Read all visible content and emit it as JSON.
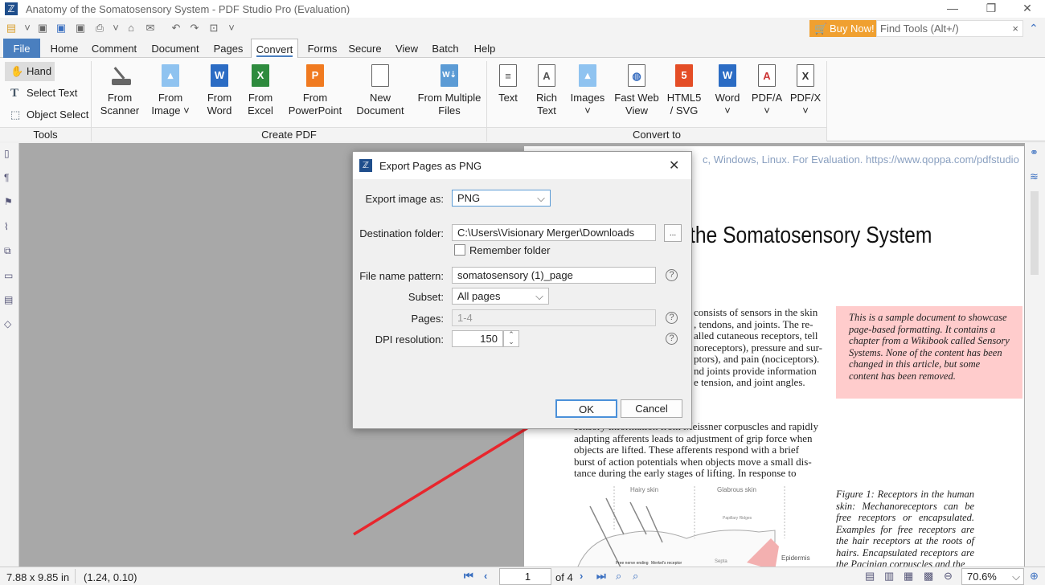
{
  "window": {
    "title": "Anatomy of the Somatosensory System - PDF Studio Pro (Evaluation)",
    "minimize": "—",
    "restore": "❐",
    "close": "✕"
  },
  "quick_toolbar": {
    "buy_now": "Buy Now!",
    "find_tools_placeholder": "Find Tools  (Alt+/)",
    "find_clear": "×"
  },
  "menu": {
    "tabs": [
      "File",
      "Home",
      "Comment",
      "Document",
      "Pages",
      "Convert",
      "Forms",
      "Secure",
      "View",
      "Batch",
      "Help"
    ],
    "active": "Convert"
  },
  "ribbon": {
    "tools": {
      "label": "Tools",
      "items": [
        "Hand",
        "Select Text",
        "Object Select"
      ]
    },
    "create_pdf": {
      "label": "Create PDF",
      "items": [
        [
          "From",
          "Scanner"
        ],
        [
          "From",
          "Image ˅"
        ],
        [
          "From",
          "Word"
        ],
        [
          "From",
          "Excel"
        ],
        [
          "From",
          "PowerPoint"
        ],
        [
          "New",
          "Document"
        ],
        [
          "From Multiple",
          "Files"
        ]
      ]
    },
    "convert_to": {
      "label": "Convert to",
      "items": [
        [
          "Text",
          ""
        ],
        [
          "Rich",
          "Text"
        ],
        [
          "Images",
          "˅"
        ],
        [
          "Fast Web",
          "View"
        ],
        [
          "HTML5",
          "/ SVG"
        ],
        [
          "Word",
          "˅"
        ],
        [
          "PDF/A",
          "˅"
        ],
        [
          "PDF/X",
          "˅"
        ]
      ]
    }
  },
  "dialog": {
    "title": "Export Pages as PNG",
    "close": "✕",
    "export_label": "Export image as:",
    "export_value": "PNG",
    "dest_label": "Destination folder:",
    "dest_value": "C:\\Users\\Visionary Merger\\Downloads",
    "browse": "...",
    "remember_label": "Remember folder",
    "pattern_label": "File name pattern:",
    "pattern_value": "somatosensory (1)_page",
    "subset_label": "Subset:",
    "subset_value": "All pages",
    "pages_label": "Pages:",
    "pages_placeholder": "1-4",
    "dpi_label": "DPI resolution:",
    "dpi_value": "150",
    "help": "?",
    "ok": "OK",
    "cancel": "Cancel"
  },
  "document": {
    "watermark": "c, Windows, Linux. For Evaluation. https://www.qoppa.com/pdfstudio",
    "title": "the Somatosensory System",
    "para1": [
      "consists of sensors in the skin",
      ", tendons, and joints. The re-",
      "alled cutaneous receptors, tell",
      "noreceptors), pressure and sur-",
      "ptors), and pain (nociceptors).",
      "nd joints provide information",
      "e tension, and joint angles."
    ],
    "sidebox": "This is a sample document to showcase page-based formatting. It contains a chapter from a Wikibook called Sensory Systems. None of the content has been changed in this article, but some content has been removed.",
    "para2": [
      "sensory information from Meissner corpuscles and rapidly",
      "adapting afferents leads to adjustment of grip force when",
      "objects are lifted. These afferents respond with a brief",
      "burst of action potentials when objects move a small dis-",
      "tance during the early stages of lifting. In response to"
    ],
    "figure_labels": {
      "hairy": "Hairy skin",
      "glabrous": "Glabrous skin",
      "papillary": "Papillary Ridges",
      "septa": "Septa",
      "epidermis": "Epidermis",
      "free": "Free nerve ending",
      "merkel": "Merkel's receptor"
    },
    "caption": "Figure 1:  Receptors in the human skin: Mechanoreceptors can be free receptors or encapsulated. Examples for free receptors are the hair receptors at the roots of hairs. Encapsulated receptors are the Pacinian corpuscles and the"
  },
  "status": {
    "page_size": "7.88 x 9.85 in",
    "cursor": "(1.24, 0.10)",
    "page_number": "1",
    "page_of": "of 4",
    "zoom": "70.6%"
  },
  "colors": {
    "accent": "#4a7fbf",
    "buy_now": "#f0a030",
    "sidebox": "#ffcccc",
    "arrow": "#e8262d"
  }
}
